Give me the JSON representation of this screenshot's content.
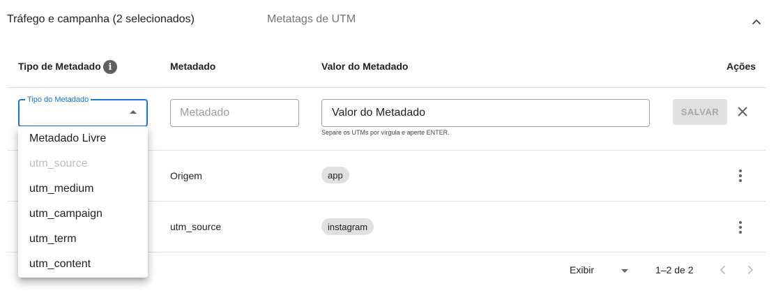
{
  "header": {
    "title": "Tráfego e campanha (2 selecionados)",
    "subtitle": "Metatags de UTM"
  },
  "columns": {
    "tipo": "Tipo de Metadado",
    "metadado": "Metadado",
    "valor": "Valor do Metadado",
    "acoes": "Ações"
  },
  "edit_row": {
    "tipo_label": "Tipo do Metadado",
    "metadado_placeholder": "Metadado",
    "valor_placeholder": "Valor do Metadado",
    "helper_text": "Separe os UTMs por vírgula e aperte ENTER.",
    "save_label": "SALVAR"
  },
  "rows": [
    {
      "metadado": "Origem",
      "valor": "app"
    },
    {
      "metadado": "utm_source",
      "valor": "instagram"
    }
  ],
  "dropdown": {
    "options": [
      {
        "label": "Metadado Livre",
        "disabled": false
      },
      {
        "label": "utm_source",
        "disabled": true
      },
      {
        "label": "utm_medium",
        "disabled": false
      },
      {
        "label": "utm_campaign",
        "disabled": false
      },
      {
        "label": "utm_term",
        "disabled": false
      },
      {
        "label": "utm_content",
        "disabled": false
      }
    ]
  },
  "pagination": {
    "rows_label": "Exibir",
    "range": "1–2 de 2"
  },
  "icons": {
    "collapse": "chevron-up-icon",
    "info": "info-icon",
    "close": "close-icon",
    "more": "more-vert-icon",
    "prev": "chevron-left-icon",
    "next": "chevron-right-icon"
  },
  "colors": {
    "accent": "#1976d2",
    "divider": "#e0e0e0",
    "chip": "#e0e0e0"
  }
}
